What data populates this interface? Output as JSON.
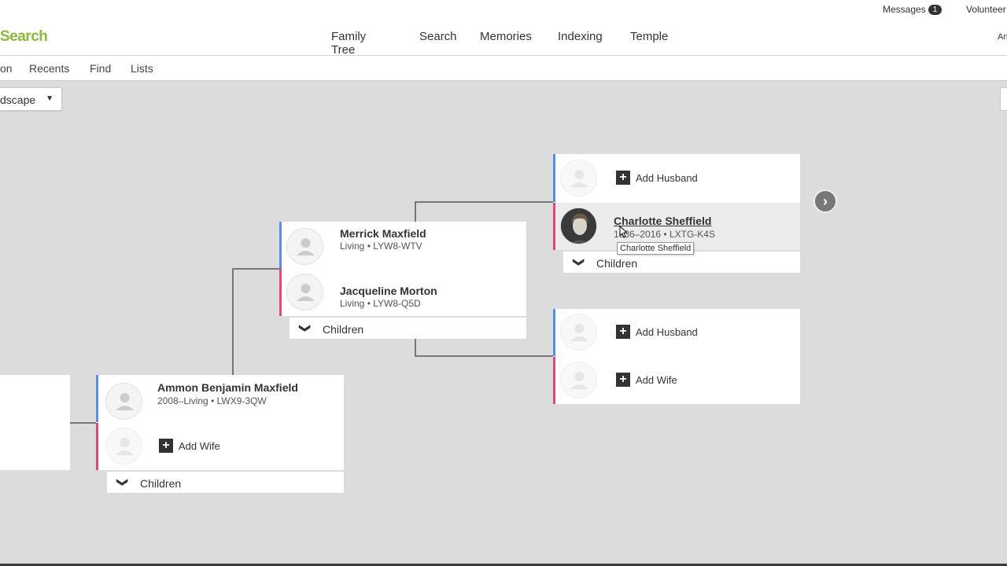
{
  "header": {
    "logo": "Search",
    "messages_label": "Messages",
    "messages_count": "1",
    "volunteer_label": "Volunteer",
    "account_label": "An",
    "nav": [
      "Family Tree",
      "Search",
      "Memories",
      "Indexing",
      "Temple"
    ]
  },
  "subnav": {
    "items": [
      "on",
      "Recents",
      "Find",
      "Lists"
    ]
  },
  "view_select": {
    "value": "dscape"
  },
  "tree": {
    "root": {
      "name": "Ammon Benjamin Maxfield",
      "lifespan": "2008–Living",
      "id": "LWX9-3QW",
      "add_wife_label": "Add Wife",
      "children_label": "Children"
    },
    "parents": {
      "father": {
        "name": "Merrick Maxfield",
        "lifespan": "Living",
        "id": "LYW8-WTV"
      },
      "mother": {
        "name": "Jacqueline Morton",
        "lifespan": "Living",
        "id": "LYW8-Q5D"
      },
      "children_label": "Children"
    },
    "paternal_grandparents": {
      "add_husband_label": "Add Husband",
      "mother": {
        "name": "Charlotte Sheffield",
        "lifespan": "1936–2016",
        "id": "LXTG-K4S"
      },
      "tooltip": "Charlotte Sheffield",
      "children_label": "Children"
    },
    "maternal_grandparents": {
      "add_husband_label": "Add Husband",
      "add_wife_label": "Add Wife"
    }
  },
  "icons": {
    "chevron_down": "❯",
    "plus": "+",
    "next": "›"
  },
  "colors": {
    "logo": "#8cb83c",
    "male_bar": "#5a8fe0",
    "female_bar": "#d64a7e",
    "canvas": "#dcdcdc"
  }
}
